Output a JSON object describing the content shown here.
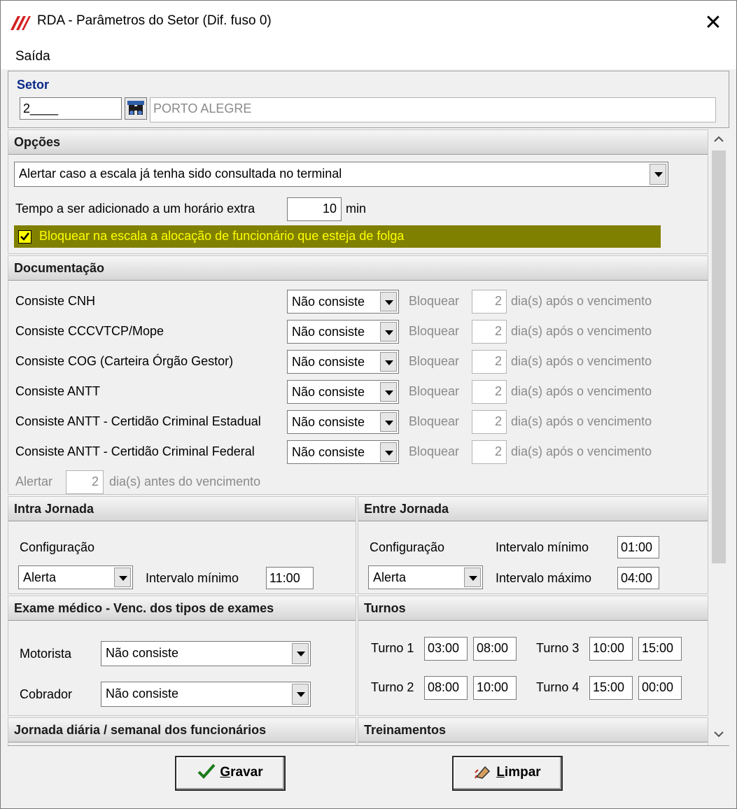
{
  "window": {
    "title": "RDA - Parâmetros do Setor (Dif. fuso 0)",
    "close_symbol": "✕"
  },
  "menu": {
    "items": [
      "Saída"
    ]
  },
  "setor": {
    "label": "Setor",
    "code": "2____",
    "name": "PORTO ALEGRE",
    "search_icon": "binoculars-icon"
  },
  "opcoes": {
    "title": "Opções",
    "alert_select": "Alertar caso a escala já tenha sido consultada no terminal",
    "tempo_label": "Tempo a ser adicionado a um horário extra",
    "tempo_value": "10",
    "tempo_unit": "min",
    "bloquear_checkbox": "Bloquear na escala a alocação de funcionário que esteja de folga",
    "bloquear_checked": true,
    "highlight_color": "#808000",
    "highlight_text_color": "#ffff00"
  },
  "documentacao": {
    "title": "Documentação",
    "rows": [
      {
        "label": "Consiste CNH",
        "select": "Não consiste",
        "bloquear": "Bloquear",
        "dias": "2",
        "suffix": "dia(s) após o vencimento"
      },
      {
        "label": "Consiste CCCVTCP/Mope",
        "select": "Não consiste",
        "bloquear": "Bloquear",
        "dias": "2",
        "suffix": "dia(s) após o vencimento"
      },
      {
        "label": "Consiste COG (Carteira Órgão Gestor)",
        "select": "Não consiste",
        "bloquear": "Bloquear",
        "dias": "2",
        "suffix": "dia(s) após o vencimento"
      },
      {
        "label": "Consiste ANTT",
        "select": "Não consiste",
        "bloquear": "Bloquear",
        "dias": "2",
        "suffix": "dia(s) após o vencimento"
      },
      {
        "label": "Consiste ANTT - Certidão Criminal Estadual",
        "select": "Não consiste",
        "bloquear": "Bloquear",
        "dias": "2",
        "suffix": "dia(s) após o vencimento"
      },
      {
        "label": "Consiste ANTT - Certidão Criminal Federal",
        "select": "Não consiste",
        "bloquear": "Bloquear",
        "dias": "2",
        "suffix": "dia(s) após o vencimento"
      }
    ],
    "alertar_label": "Alertar",
    "alertar_value": "2",
    "alertar_suffix": "dia(s) antes do vencimento"
  },
  "intra": {
    "title": "Intra Jornada",
    "config_label": "Configuração",
    "config_value": "Alerta",
    "intervalo_label": "Intervalo mínimo",
    "intervalo_value": "11:00"
  },
  "entre": {
    "title": "Entre Jornada",
    "config_label": "Configuração",
    "config_value": "Alerta",
    "min_label": "Intervalo mínimo",
    "min_value": "01:00",
    "max_label": "Intervalo máximo",
    "max_value": "04:00"
  },
  "exame": {
    "title": "Exame médico - Venc. dos tipos de exames",
    "motorista_label": "Motorista",
    "motorista_value": "Não consiste",
    "cobrador_label": "Cobrador",
    "cobrador_value": "Não consiste"
  },
  "turnos": {
    "title": "Turnos",
    "items": [
      {
        "label": "Turno 1",
        "start": "03:00",
        "end": "08:00"
      },
      {
        "label": "Turno 2",
        "start": "08:00",
        "end": "10:00"
      },
      {
        "label": "Turno 3",
        "start": "10:00",
        "end": "15:00"
      },
      {
        "label": "Turno 4",
        "start": "15:00",
        "end": "00:00"
      }
    ]
  },
  "jornada": {
    "title": "Jornada diária / semanal dos funcionários"
  },
  "treinamentos": {
    "title": "Treinamentos"
  },
  "buttons": {
    "gravar_mnemonic": "G",
    "gravar_rest": "ravar",
    "limpar_mnemonic": "L",
    "limpar_rest": "impar"
  }
}
